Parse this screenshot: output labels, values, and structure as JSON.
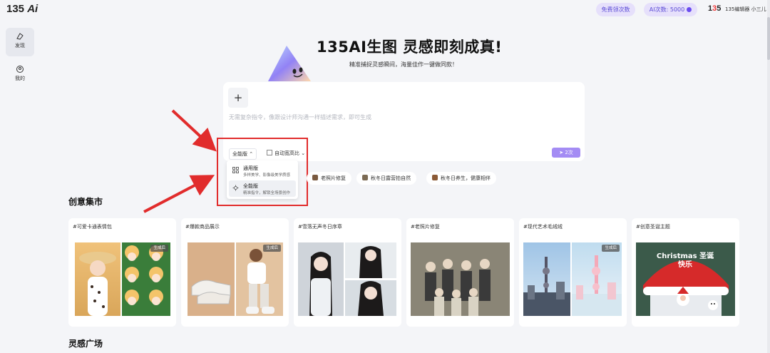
{
  "header": {
    "logo_main": "135",
    "logo_ai": "Ai",
    "free_button": "免费领次数",
    "ai_count": "AI次数: 5000",
    "user_logo_a": "1",
    "user_logo_b": "3",
    "user_logo_c": "5",
    "user_name": "135编辑器 小三儿"
  },
  "sidebar": {
    "items": [
      {
        "label": "发现",
        "icon": "discover-icon"
      },
      {
        "label": "我的",
        "icon": "profile-icon"
      }
    ]
  },
  "hero": {
    "title": "135AI生图 灵感即刻成真!",
    "subtitle": "精准捕捉灵感瞬间，海量佳作一键做同款！"
  },
  "composer": {
    "placeholder": "无需复杂指令，像跟设计师沟通一样描述需求，即可生成",
    "mode_label": "全能版",
    "ratio_label": "自动宽高比",
    "send_label": "2次"
  },
  "mode_menu": [
    {
      "title": "通用版",
      "desc": "多样美学、影像级美学质感",
      "icon": "grid-icon"
    },
    {
      "title": "全能版",
      "desc": "精准指令，解锁全场景创作",
      "icon": "gear-icon"
    }
  ],
  "chips": [
    {
      "label": "老照片修复"
    },
    {
      "label": "秋冬日露营拍自然"
    },
    {
      "label": "秋冬日养生，健康相伴"
    }
  ],
  "sections": {
    "creative": "创意集市",
    "inspiration": "灵感广场"
  },
  "cards": [
    {
      "tag": "#可爱卡通表情包",
      "badge": "生成后"
    },
    {
      "tag": "#爆款商品展示",
      "badge": "生成后"
    },
    {
      "tag": "#雪落无声冬日序章",
      "badge": ""
    },
    {
      "tag": "#老照片修复",
      "badge": ""
    },
    {
      "tag": "#现代艺术毛绒绒",
      "badge": "生成后"
    },
    {
      "tag": "#创意圣诞主题",
      "badge": "Christmas 圣诞快乐"
    }
  ],
  "colors": {
    "accent": "#6b4cf0",
    "annotation_red": "#e12c2c"
  }
}
